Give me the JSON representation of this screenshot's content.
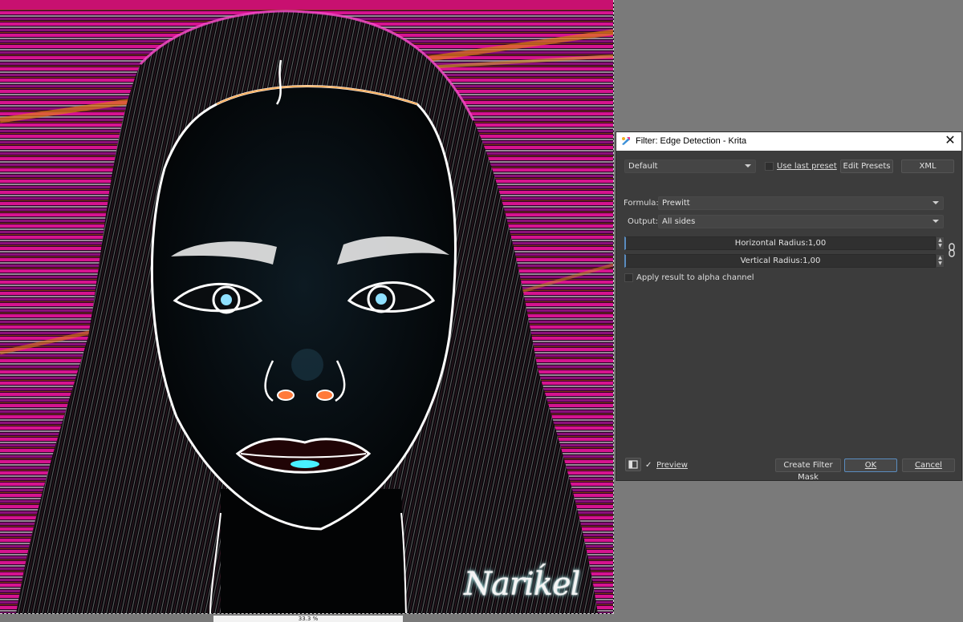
{
  "canvas": {
    "signature_text": "Nariḱel",
    "status_text": "33.3 %"
  },
  "dialog": {
    "title": "Filter: Edge Detection - Krita",
    "close_glyph": "✕",
    "preset": {
      "selected": "Default",
      "use_last_preset_label": "Use last preset",
      "use_last_preset_checked": false,
      "edit_presets_label": "Edit Presets",
      "xml_label": "XML"
    },
    "formula": {
      "label": "Formula:",
      "value": "Prewitt"
    },
    "output": {
      "label": "Output:",
      "value": "All sides"
    },
    "horizontal_radius": {
      "text": "Horizontal Radius:1,00",
      "value": 1.0
    },
    "vertical_radius": {
      "text": "Vertical Radius:1,00",
      "value": 1.0
    },
    "apply_alpha": {
      "label": "Apply result to alpha channel",
      "checked": false
    },
    "footer": {
      "preview_label": "Preview",
      "preview_check_glyph": "✓",
      "preview_checked": true,
      "create_filter_mask_label": "Create Filter Mask",
      "ok_label": "OK",
      "cancel_label": "Cancel"
    },
    "icons": {
      "app": "krita-icon",
      "close": "close-icon",
      "chain": "chain-link-icon",
      "layout": "split-view-icon"
    }
  },
  "colors": {
    "dialog_bg": "#3c3c3c",
    "accent": "#5a8cbf",
    "canvas_bg": "#05050a"
  }
}
